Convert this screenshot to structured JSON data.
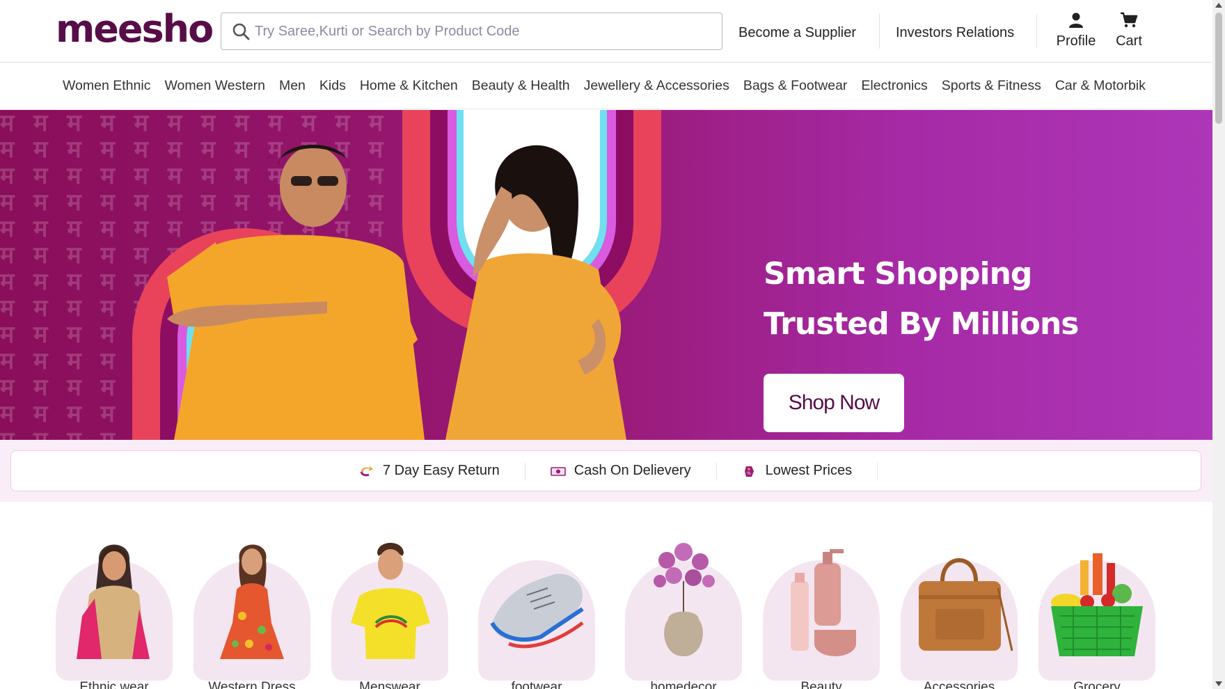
{
  "header": {
    "logo": "meesho",
    "search_placeholder": "Try Saree,Kurti or Search by Product Code",
    "become_supplier": "Become a Supplier",
    "investors": "Investors Relations",
    "profile": "Profile",
    "cart": "Cart"
  },
  "categories_nav": [
    "Women Ethnic",
    "Women Western",
    "Men",
    "Kids",
    "Home & Kitchen",
    "Beauty & Health",
    "Jewellery & Accessories",
    "Bags & Footwear",
    "Electronics",
    "Sports & Fitness",
    "Car & Motorbik"
  ],
  "banner": {
    "line1": "Smart Shopping",
    "line2": "Trusted By Millions",
    "cta": "Shop Now",
    "colors": {
      "primary": "#570d48",
      "banner": "#9a1a78"
    }
  },
  "usp": [
    {
      "label": "7 Day Easy Return",
      "icon": "return-icon"
    },
    {
      "label": "Cash On Delievery",
      "icon": "cash-icon"
    },
    {
      "label": "Lowest Prices",
      "icon": "price-tag-icon"
    }
  ],
  "tiles": [
    {
      "label": "Ethnic wear",
      "icon": "ethnic-wear-image"
    },
    {
      "label": "Western Dress",
      "icon": "western-dress-image"
    },
    {
      "label": "Menswear",
      "icon": "menswear-image"
    },
    {
      "label": "footwear",
      "icon": "footwear-image"
    },
    {
      "label": "homedecor",
      "icon": "homedecor-image"
    },
    {
      "label": "Beauty",
      "icon": "beauty-image"
    },
    {
      "label": "Accessories",
      "icon": "accessories-image"
    },
    {
      "label": "Grocery",
      "icon": "grocery-image"
    }
  ]
}
